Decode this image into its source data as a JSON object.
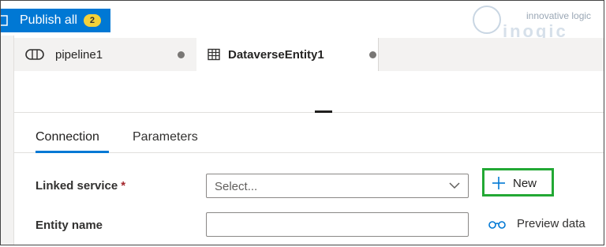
{
  "toolbar": {
    "publish_label": "Publish all",
    "publish_count": "2"
  },
  "brand": {
    "tagline": "innovative logic",
    "name": "inogic"
  },
  "tabs": [
    {
      "label": "pipeline1",
      "icon": "pipeline-icon",
      "active": false,
      "unsaved": true
    },
    {
      "label": "DataverseEntity1",
      "icon": "table-icon",
      "active": true,
      "unsaved": true
    }
  ],
  "properties": {
    "subtabs": [
      {
        "label": "Connection",
        "selected": true
      },
      {
        "label": "Parameters",
        "selected": false
      }
    ],
    "linked_service": {
      "label": "Linked service",
      "required_mark": "*",
      "placeholder": "Select..."
    },
    "new_label": "New",
    "entity_name": {
      "label": "Entity name",
      "value": ""
    },
    "preview_label": "Preview data"
  },
  "colors": {
    "accent": "#0078d4",
    "badge": "#f3d13a",
    "highlight": "#22a834",
    "required": "#a4262c"
  }
}
